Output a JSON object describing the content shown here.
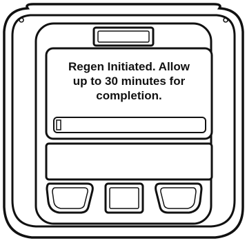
{
  "display": {
    "message_lines": [
      "Regen Initiated. Allow",
      "up to 30 minutes for",
      "completion."
    ],
    "progress": 0.03
  },
  "colors": {
    "outline": "#111111",
    "background": "#ffffff"
  }
}
